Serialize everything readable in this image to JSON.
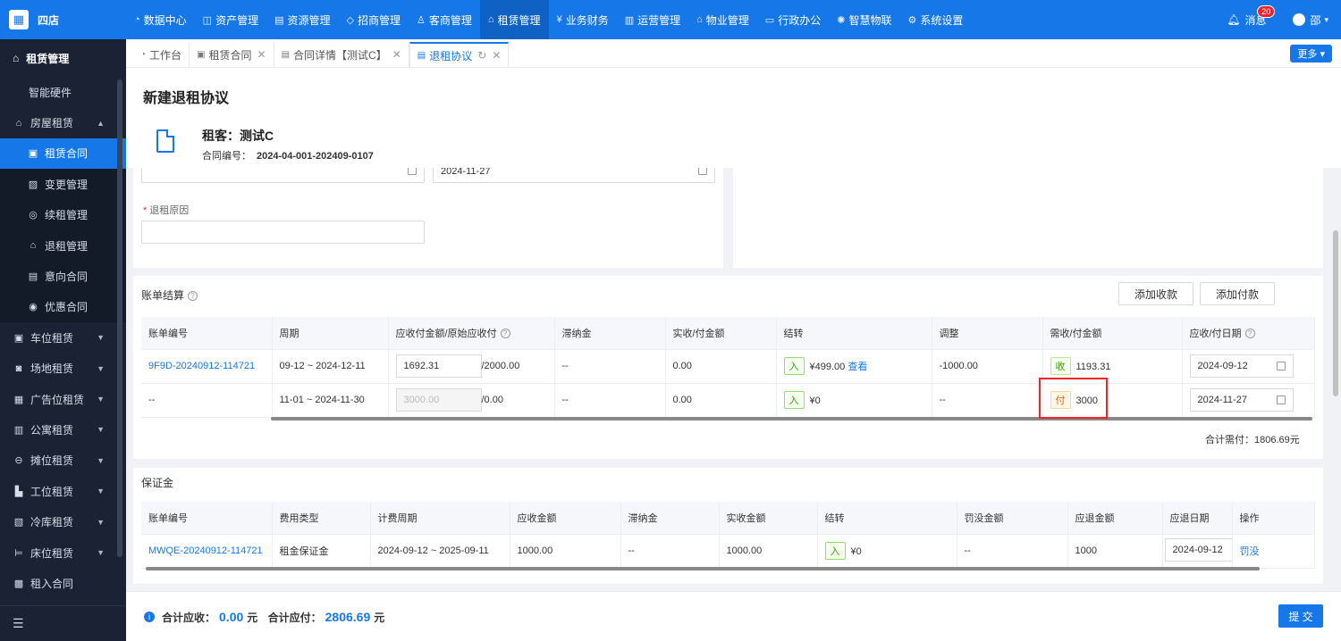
{
  "app": {
    "logo_text": "四店"
  },
  "topnav": [
    {
      "label": "数据中心",
      "icon": "◔"
    },
    {
      "label": "资产管理",
      "icon": "◫"
    },
    {
      "label": "资源管理",
      "icon": "▤"
    },
    {
      "label": "招商管理",
      "icon": "◇"
    },
    {
      "label": "客商管理",
      "icon": "♙"
    },
    {
      "label": "租赁管理",
      "icon": "⌂"
    },
    {
      "label": "业务财务",
      "icon": "¥"
    },
    {
      "label": "运营管理",
      "icon": "▥"
    },
    {
      "label": "物业管理",
      "icon": "⌂"
    },
    {
      "label": "行政办公",
      "icon": "▭"
    },
    {
      "label": "智慧物联",
      "icon": "✺"
    },
    {
      "label": "系统设置",
      "icon": "⚙"
    }
  ],
  "header_right": {
    "messages_label": "消息",
    "messages_count": "20",
    "user_name": "邵"
  },
  "sidebar": {
    "title": "租赁管理",
    "items": [
      {
        "label": "智能硬件"
      },
      {
        "label": "房屋租赁"
      },
      {
        "label": "租赁合同"
      },
      {
        "label": "变更管理"
      },
      {
        "label": "续租管理"
      },
      {
        "label": "退租管理"
      },
      {
        "label": "意向合同"
      },
      {
        "label": "优惠合同"
      },
      {
        "label": "车位租赁"
      },
      {
        "label": "场地租赁"
      },
      {
        "label": "广告位租赁"
      },
      {
        "label": "公寓租赁"
      },
      {
        "label": "摊位租赁"
      },
      {
        "label": "工位租赁"
      },
      {
        "label": "冷库租赁"
      },
      {
        "label": "床位租赁"
      },
      {
        "label": "租入合同"
      }
    ]
  },
  "tabs": [
    {
      "label": "工作台"
    },
    {
      "label": "租赁合同"
    },
    {
      "label": "合同详情【测试C】"
    },
    {
      "label": "退租协议"
    }
  ],
  "more_label": "更多",
  "page": {
    "title": "新建退租协议",
    "tenant": "租客：测试C",
    "contract_no_label": "合同编号：",
    "contract_no": "2024-04-001-202409-0107",
    "date_value": "2024-11-27",
    "reason_label": "退租原因"
  },
  "billing": {
    "title": "账单结算",
    "add_receipt": "添加收款",
    "add_payment": "添加付款",
    "columns": [
      "账单编号",
      "周期",
      "应收付金额/原始应收付",
      "滞纳金",
      "实收/付金额",
      "结转",
      "调整",
      "需收/付金额",
      "应收/付日期"
    ],
    "rows": [
      {
        "id": "9F9D-20240912-114721",
        "period": "09-12 ~ 2024-12-11",
        "amount": "1692.31",
        "orig": "/2000.00",
        "late": "--",
        "paid": "0.00",
        "carry_tag": "入",
        "carry": "¥499.00",
        "view": "查看",
        "adjust": "-1000.00",
        "need_tag": "收",
        "need": "1193.31",
        "date": "2024-09-12"
      },
      {
        "id": "--",
        "period": "11-01 ~ 2024-11-30",
        "amount": "3000.00",
        "orig": "/0.00",
        "late": "--",
        "paid": "0.00",
        "carry_tag": "入",
        "carry": "¥0",
        "view": "",
        "adjust": "--",
        "need_tag": "付",
        "need": "3000",
        "date": "2024-11-27"
      }
    ],
    "total": "合计需付：1806.69元"
  },
  "deposit": {
    "title": "保证金",
    "columns": [
      "账单编号",
      "费用类型",
      "计费周期",
      "应收金额",
      "滞纳金",
      "实收金额",
      "结转",
      "罚没金额",
      "应退金额",
      "应退日期",
      "操作"
    ],
    "row": {
      "id": "MWQE-20240912-114721",
      "type": "租金保证金",
      "period": "2024-09-12 ~ 2025-09-11",
      "due": "1000.00",
      "late": "--",
      "paid": "1000.00",
      "carry_tag": "入",
      "carry": "¥0",
      "penalty": "--",
      "refund": "1000",
      "date": "2024-09-12",
      "action": "罚没"
    }
  },
  "footer": {
    "receivable_label": "合计应收：",
    "receivable": "0.00",
    "unit1": "元",
    "payable_label": "合计应付：",
    "payable": "2806.69",
    "unit2": "元",
    "submit": "提 交"
  }
}
